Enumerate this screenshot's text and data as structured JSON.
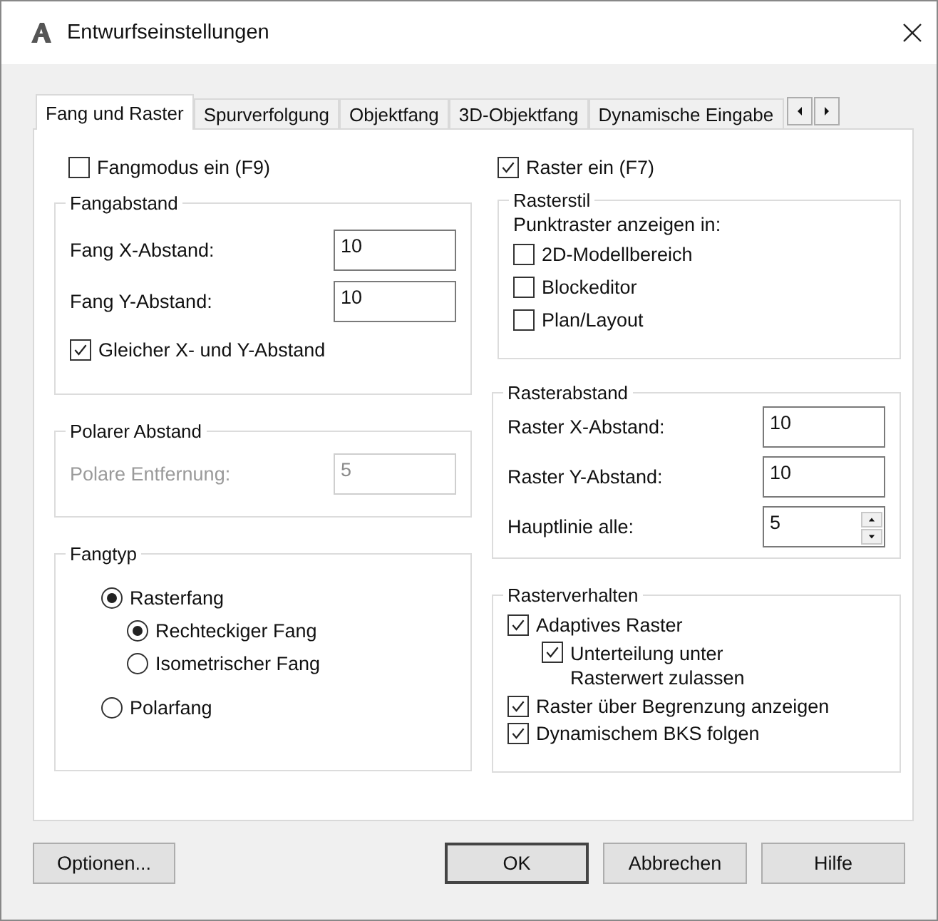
{
  "window": {
    "title": "Entwurfseinstellungen"
  },
  "tabs": [
    {
      "label": "Fang und Raster",
      "selected": true
    },
    {
      "label": "Spurverfolgung",
      "selected": false
    },
    {
      "label": "Objektfang",
      "selected": false
    },
    {
      "label": "3D-Objektfang",
      "selected": false
    },
    {
      "label": "Dynamische Eingabe",
      "selected": false
    }
  ],
  "snap_mode": {
    "label": "Fangmodus ein (F9)",
    "checked": false
  },
  "grid_mode": {
    "label": "Raster ein (F7)",
    "checked": true
  },
  "snap_spacing": {
    "title": "Fangabstand",
    "fields": [
      {
        "label": "Fang X-Abstand:",
        "value": "10",
        "kind": "text"
      },
      {
        "label": "Fang Y-Abstand:",
        "value": "10",
        "kind": "text"
      }
    ],
    "equal": {
      "label": "Gleicher X- und Y-Abstand",
      "checked": true
    }
  },
  "polar_spacing": {
    "title": "Polarer Abstand",
    "disabled": true,
    "field": {
      "label": "Polare Entfernung:",
      "value": "5",
      "kind": "text"
    }
  },
  "snap_type": {
    "title": "Fangtyp",
    "options": [
      {
        "label": "Rasterfang",
        "selected": true,
        "children": [
          {
            "label": "Rechteckiger Fang",
            "selected": true
          },
          {
            "label": "Isometrischer Fang",
            "selected": false
          }
        ]
      },
      {
        "label": "Polarfang",
        "selected": false
      }
    ]
  },
  "grid_style": {
    "title": "Rasterstil",
    "caption": "Punktraster anzeigen in:",
    "options": [
      {
        "label": "2D-Modellbereich",
        "checked": false
      },
      {
        "label": "Blockeditor",
        "checked": false
      },
      {
        "label": "Plan/Layout",
        "checked": false
      }
    ]
  },
  "grid_spacing": {
    "title": "Rasterabstand",
    "fields": [
      {
        "label": "Raster X-Abstand:",
        "value": "10",
        "kind": "text"
      },
      {
        "label": "Raster Y-Abstand:",
        "value": "10",
        "kind": "text"
      },
      {
        "label": "Hauptlinie alle:",
        "value": "5",
        "kind": "spinner"
      }
    ]
  },
  "grid_behavior": {
    "title": "Rasterverhalten",
    "options": [
      {
        "label": "Adaptives Raster",
        "checked": true,
        "children": [
          {
            "label": "Unterteilung unter Rasterwert zulassen",
            "checked": true
          }
        ]
      },
      {
        "label": "Raster über Begrenzung anzeigen",
        "checked": true
      },
      {
        "label": "Dynamischem BKS folgen",
        "checked": true
      }
    ]
  },
  "buttons": [
    {
      "label": "Optionen...",
      "default": false
    },
    {
      "label": "OK",
      "default": true
    },
    {
      "label": "Abbrechen",
      "default": false
    },
    {
      "label": "Hilfe",
      "default": false
    }
  ]
}
